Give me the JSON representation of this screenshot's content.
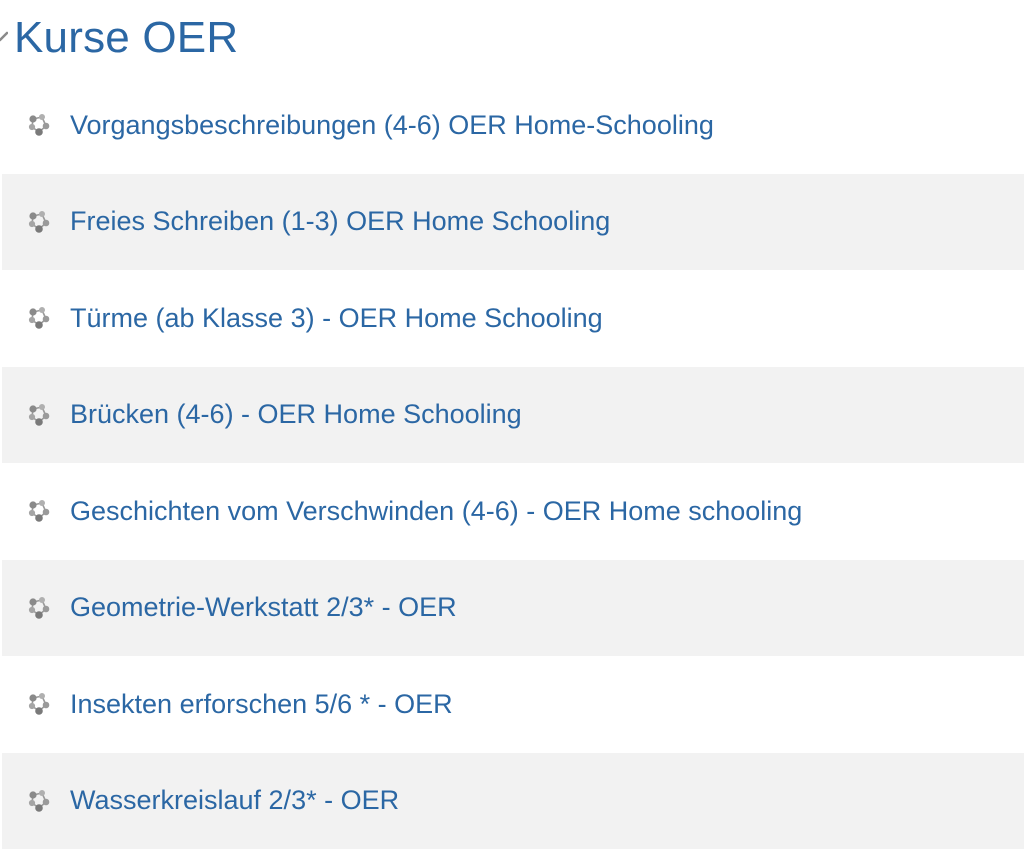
{
  "category": {
    "title": "Kurse OER",
    "chevron_icon": "chevron-down-icon"
  },
  "courses": [
    {
      "name": "Vorgangsbeschreibungen (4-6) OER Home-Schooling",
      "icon": "course-icon"
    },
    {
      "name": "Freies Schreiben (1-3) OER Home Schooling",
      "icon": "course-icon"
    },
    {
      "name": "Türme (ab Klasse 3) - OER Home Schooling",
      "icon": "course-icon"
    },
    {
      "name": "Brücken (4-6) - OER Home Schooling",
      "icon": "course-icon"
    },
    {
      "name": "Geschichten vom Verschwinden (4-6) - OER Home schooling",
      "icon": "course-icon"
    },
    {
      "name": "Geometrie-Werkstatt 2/3* - OER",
      "icon": "course-icon"
    },
    {
      "name": "Insekten erforschen 5/6 * - OER",
      "icon": "course-icon"
    },
    {
      "name": "Wasserkreislauf 2/3* - OER",
      "icon": "course-icon"
    }
  ],
  "colors": {
    "link": "#2b67a4",
    "row_alt": "#f2f2f2",
    "icon": "#8a8a8a"
  }
}
